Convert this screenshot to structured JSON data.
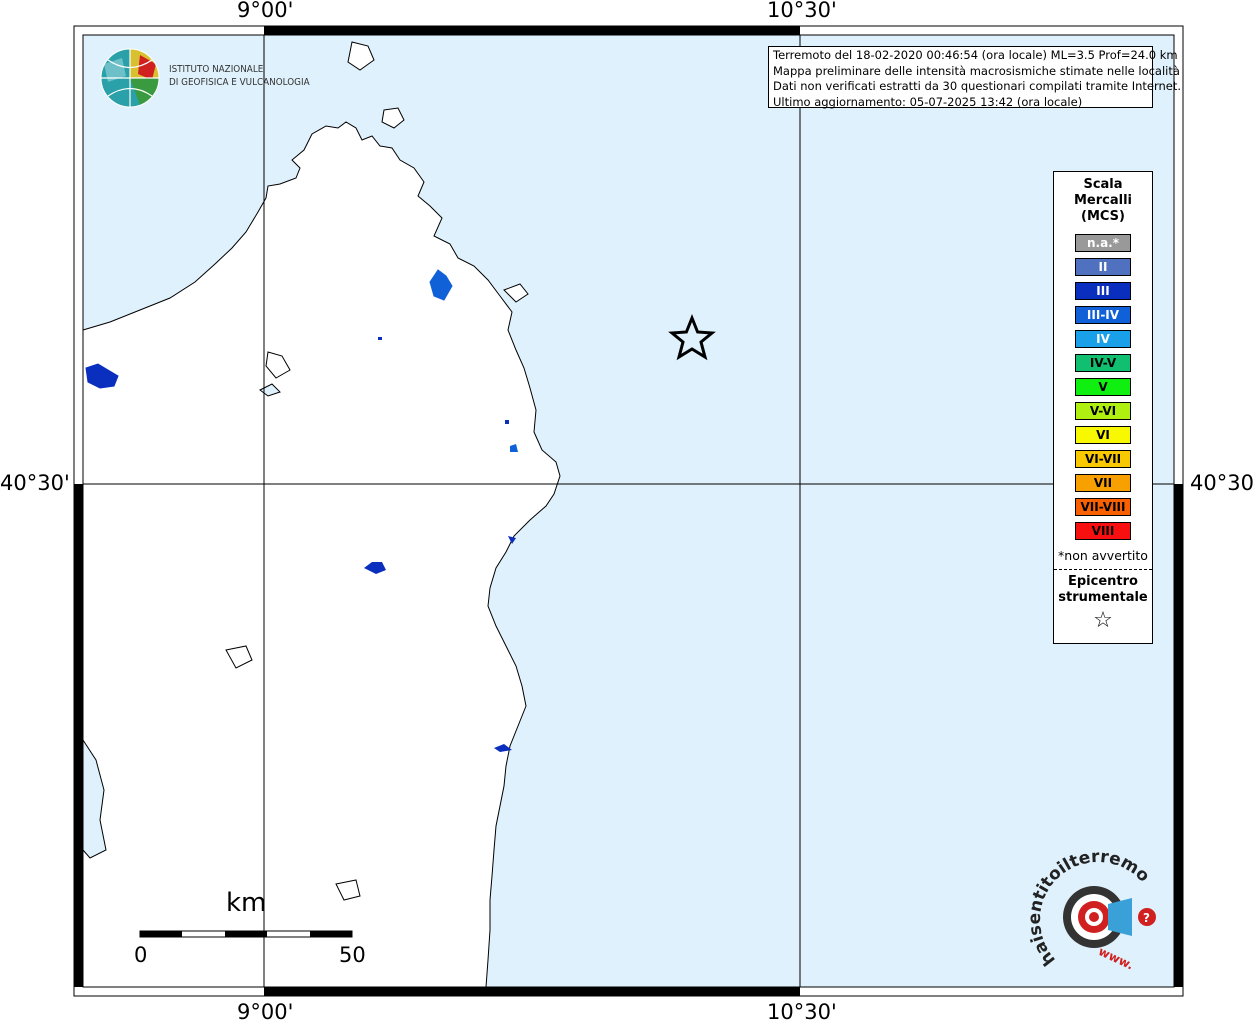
{
  "map": {
    "lon_labels": [
      "9°00'",
      "10°30'"
    ],
    "lat_labels": [
      "40°30'"
    ]
  },
  "logo": {
    "line1": "ISTITUTO NAZIONALE",
    "line2": "DI GEOFISICA E VULCANOLOGIA"
  },
  "info": {
    "line1": "Terremoto del 18-02-2020 00:46:54 (ora locale) ML=3.5 Prof=24.0 km",
    "line2": "Mappa preliminare delle intensità macrosismiche stimate nelle località",
    "line3": "Dati non verificati estratti da 30 questionari compilati tramite Internet.",
    "line4": "Ultimo aggiornamento: 05-07-2025 13:42 (ora locale)"
  },
  "legend": {
    "title_lines": [
      "Scala",
      "Mercalli",
      "(MCS)"
    ],
    "items": [
      {
        "label": "n.a.*",
        "color": "#999999",
        "text_color": "#ffffff"
      },
      {
        "label": "II",
        "color": "#5070c0",
        "text_color": "#ffffff"
      },
      {
        "label": "III",
        "color": "#0a2ebe",
        "text_color": "#ffffff"
      },
      {
        "label": "III-IV",
        "color": "#1060d8",
        "text_color": "#ffffff"
      },
      {
        "label": "IV",
        "color": "#1aa0e8",
        "text_color": "#ffffff"
      },
      {
        "label": "IV-V",
        "color": "#10c070",
        "text_color": "#000000"
      },
      {
        "label": "V",
        "color": "#10f010",
        "text_color": "#000000"
      },
      {
        "label": "V-VI",
        "color": "#b0f010",
        "text_color": "#000000"
      },
      {
        "label": "VI",
        "color": "#f8f800",
        "text_color": "#000000"
      },
      {
        "label": "VI-VII",
        "color": "#f8c800",
        "text_color": "#000000"
      },
      {
        "label": "VII",
        "color": "#f8a000",
        "text_color": "#000000"
      },
      {
        "label": "VII-VIII",
        "color": "#f86000",
        "text_color": "#000000"
      },
      {
        "label": "VIII",
        "color": "#f81010",
        "text_color": "#000000"
      }
    ],
    "note": "*non avvertito",
    "epicenter_lines": [
      "Epicentro",
      "strumentale"
    ],
    "epicenter_symbol": "☆"
  },
  "scale_bar": {
    "unit": "km",
    "min_label": "0",
    "max_label": "50"
  },
  "colors": {
    "sea": "#dff1fc",
    "land": "#ffffff",
    "intensity_ii_iii": "#0a2ebe",
    "intensity_iii_iv": "#1060d8"
  },
  "watermark": {
    "text": "haisentitoilterremoto.it",
    "url": "www."
  }
}
